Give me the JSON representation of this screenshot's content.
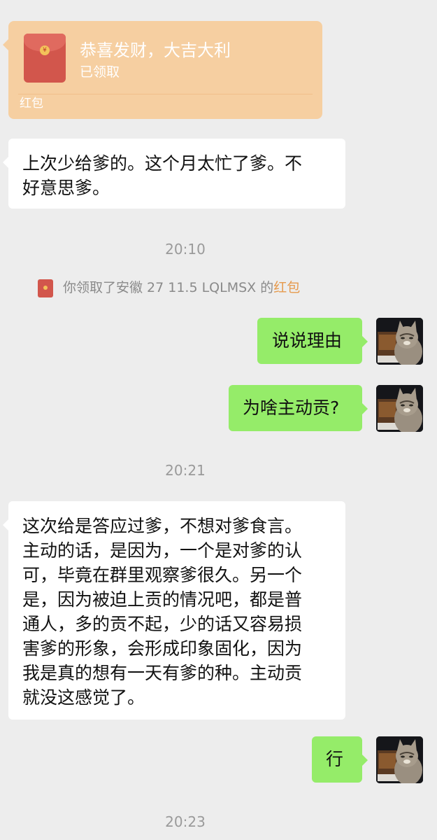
{
  "red_packet": {
    "title": "恭喜发财，大吉大利",
    "status": "已领取",
    "label": "红包",
    "seal_char": "¥"
  },
  "messages": [
    {
      "side": "left",
      "text": "上次少给爹的。这个月太忙了爹。不\n好意思爹。"
    },
    {
      "side": "right",
      "text": "说说理由"
    },
    {
      "side": "right",
      "text": "为啥主动贡?"
    },
    {
      "side": "left",
      "text": "这次给是答应过爹，不想对爹食言。\n主动的话，是因为，一个是对爹的认\n可，毕竟在群里观察爹很久。另一个\n是，因为被迫上贡的情况吧，都是普\n通人，多的贡不起，少的话又容易损\n害爹的形象，会形成印象固化，因为\n我是真的想有一天有爹的种。主动贡\n就没这感觉了。"
    },
    {
      "side": "right",
      "text": "行"
    }
  ],
  "timestamps": [
    "20:10",
    "20:21",
    "20:23"
  ],
  "system_notice": {
    "prefix": "你领取了安徽 27 11.5 LQLMSX 的",
    "link": "红包"
  },
  "colors": {
    "background": "#ededed",
    "red_packet_card": "#f6cfa1",
    "bubble_right": "#95ec69",
    "bubble_left": "#ffffff",
    "link": "#e69a4d"
  },
  "icons": {
    "avatar": "cat-avatar-icon",
    "red_packet": "red-envelope-icon"
  }
}
